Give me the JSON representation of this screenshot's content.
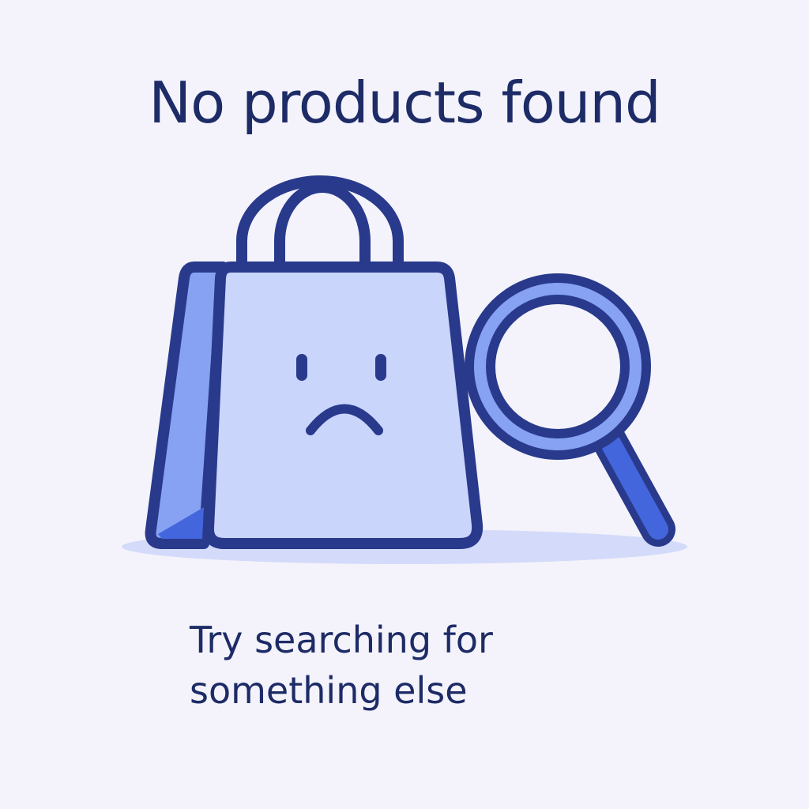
{
  "empty_state": {
    "title": "No products found",
    "hint": "Try searching for\nsomething else",
    "illustration": {
      "icons": [
        "shopping-bag-icon",
        "sad-face-icon",
        "magnifying-glass-icon"
      ]
    }
  },
  "colors": {
    "background": "#f4f3fb",
    "text": "#1d2b66",
    "outline": "#293a8c",
    "bag_fill": "#c9d5fb",
    "bag_side": "#87a2f3",
    "accent": "#4466dd",
    "shadow": "#d4daf9"
  }
}
